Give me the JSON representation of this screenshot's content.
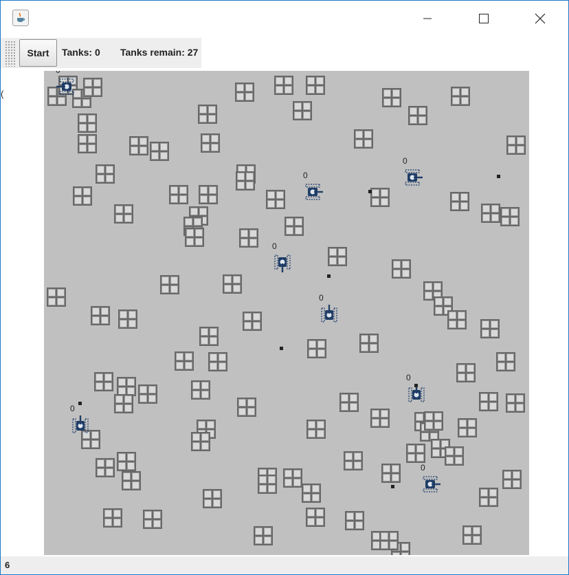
{
  "window": {
    "icon": "java-cup-icon",
    "controls": [
      "minimize-icon",
      "maximize-icon",
      "close-icon"
    ]
  },
  "toolbar": {
    "start_label": "Start",
    "tanks_text": "Tanks: 0",
    "remain_text": "Tanks remain: 27"
  },
  "left_stub": "(",
  "status": {
    "text": "6"
  },
  "game": {
    "tanks": [
      {
        "score": "0",
        "direction": "left"
      },
      {
        "score": "0",
        "direction": "right"
      },
      {
        "score": "0",
        "direction": "right"
      },
      {
        "score": "0",
        "direction": "down"
      },
      {
        "score": "0",
        "direction": "up"
      },
      {
        "score": "0",
        "direction": "up"
      },
      {
        "score": "0",
        "direction": "up"
      },
      {
        "score": "0",
        "direction": "right"
      }
    ]
  },
  "colors": {
    "field": "#c0c0c0",
    "tank": "#1f3d66",
    "window_border": "#1979ca"
  }
}
